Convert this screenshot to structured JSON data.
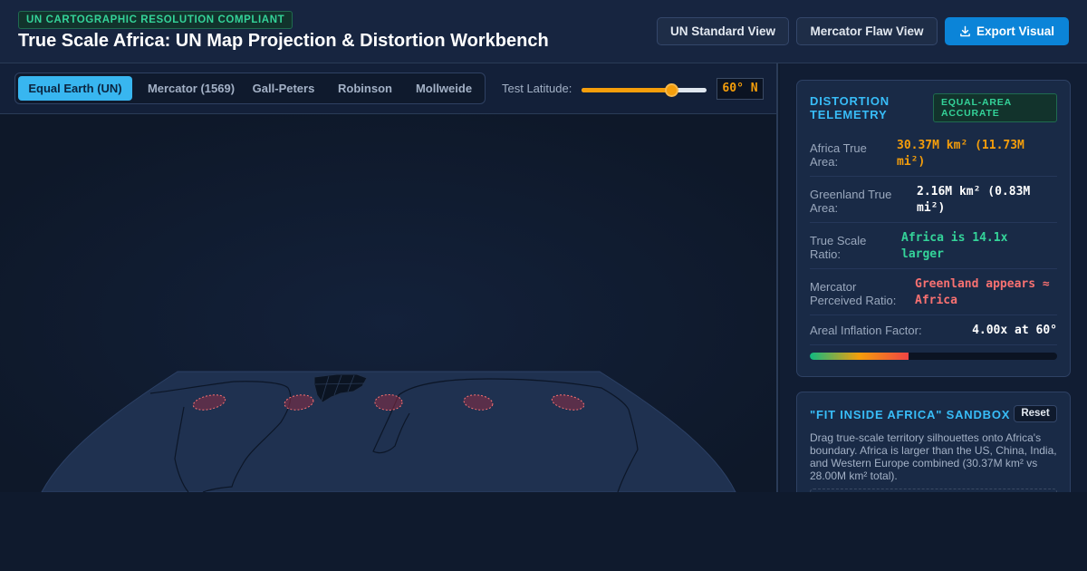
{
  "header": {
    "badge": "UN CARTOGRAPHIC RESOLUTION COMPLIANT",
    "title": "True Scale Africa: UN Map Projection & Distortion Workbench",
    "buttons": {
      "un_standard": "UN Standard View",
      "mercator_flaw": "Mercator Flaw View",
      "export": "Export Visual"
    }
  },
  "toolbar": {
    "tabs": [
      {
        "label": "Equal Earth (UN)",
        "active": true
      },
      {
        "label": "Mercator (1569)",
        "active": false
      },
      {
        "label": "Gall-Peters",
        "active": false
      },
      {
        "label": "Robinson",
        "active": false
      },
      {
        "label": "Mollweide",
        "active": false
      }
    ],
    "latitude_label": "Test Latitude:",
    "latitude_value": "60° N",
    "latitude_slider_fraction": 0.72
  },
  "telemetry": {
    "title": "DISTORTION TELEMETRY",
    "badge": "EQUAL-AREA ACCURATE",
    "rows": [
      {
        "label": "Africa True Area:",
        "value": "30.37M km² (11.73M mi²)"
      },
      {
        "label": "Greenland True Area:",
        "value": "2.16M km² (0.83M mi²)"
      },
      {
        "label": "True Scale Ratio:",
        "value": "Africa is 14.1x larger"
      },
      {
        "label": "Mercator Perceived Ratio:",
        "value": "Greenland appears ≈ Africa"
      },
      {
        "label": "Areal Inflation Factor:",
        "value": "4.00x at 60°"
      }
    ],
    "inflation_bar_fraction": 0.4
  },
  "sandbox": {
    "title": "\"FIT INSIDE AFRICA\" SANDBOX",
    "reset_label": "Reset",
    "description": "Drag true-scale territory silhouettes onto Africa's boundary. Africa is larger than the US, China, India, and Western Europe combined (30.37M km² vs 28.00M km² total)."
  },
  "colors": {
    "accent": "#38bdf8",
    "compliant_green": "#34d399",
    "warning_orange": "#f59e0b",
    "danger_red": "#f87171",
    "primary_button": "#0b84d8"
  }
}
